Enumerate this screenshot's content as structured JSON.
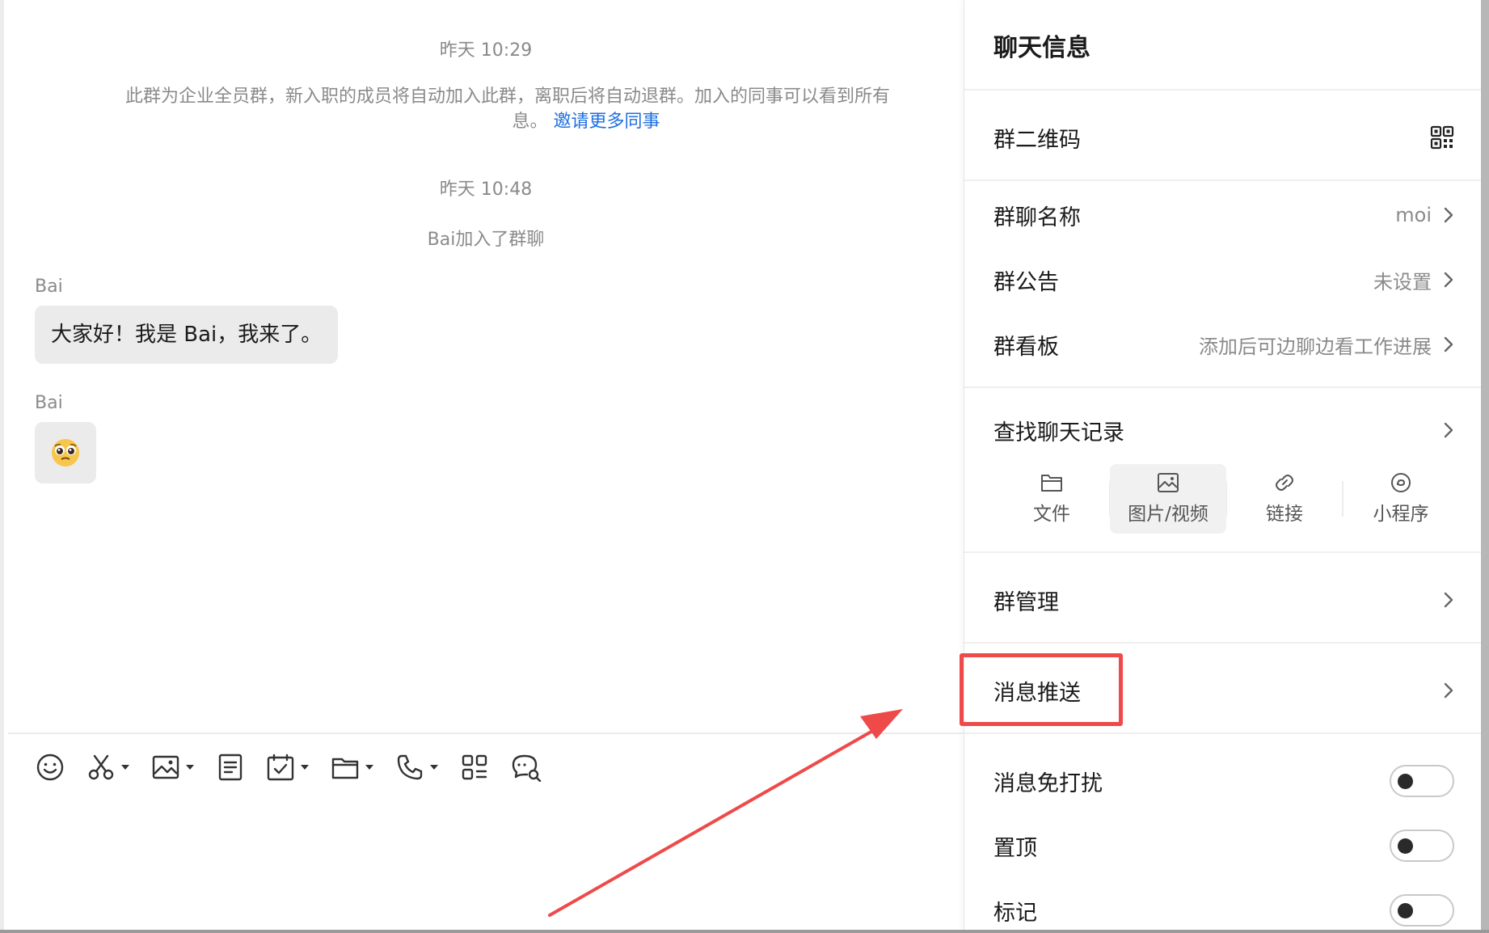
{
  "chat": {
    "timestamp_1": "昨天 10:29",
    "system_notice_line1": "此群为企业全员群，新入职的成员将自动加入此群，离职后将自动退群。加入的同事可以看到所有",
    "system_notice_line2_prefix": "息。",
    "invite_link": "邀请更多同事",
    "timestamp_2": "昨天 10:48",
    "join_notice": "Bai加入了群聊",
    "messages": [
      {
        "sender": "Bai",
        "text": "大家好！我是 Bai，我来了。"
      },
      {
        "sender": "Bai",
        "sticker": "🥺"
      }
    ]
  },
  "toolbar": {
    "tools": [
      {
        "icon": "emoji-icon",
        "has_menu": false
      },
      {
        "icon": "scissors-icon",
        "has_menu": true
      },
      {
        "icon": "image-icon",
        "has_menu": true
      },
      {
        "icon": "document-icon",
        "has_menu": false
      },
      {
        "icon": "calendar-check-icon",
        "has_menu": true
      },
      {
        "icon": "folder-icon",
        "has_menu": true
      },
      {
        "icon": "phone-icon",
        "has_menu": true
      },
      {
        "icon": "apps-grid-icon",
        "has_menu": false
      },
      {
        "icon": "chat-search-icon",
        "has_menu": false
      }
    ]
  },
  "panel": {
    "title": "聊天信息",
    "qr_code": {
      "label": "群二维码",
      "icon": "qr-code-icon"
    },
    "group_name": {
      "label": "群聊名称",
      "value": "moi"
    },
    "announcement": {
      "label": "群公告",
      "value": "未设置"
    },
    "kanban": {
      "label": "群看板",
      "value": "添加后可边聊边看工作进展"
    },
    "search_history": {
      "label": "查找聊天记录",
      "categories": [
        {
          "label": "文件",
          "icon": "folder-icon",
          "active": false
        },
        {
          "label": "图片/视频",
          "icon": "image-icon",
          "active": true
        },
        {
          "label": "链接",
          "icon": "link-icon",
          "active": false
        },
        {
          "label": "小程序",
          "icon": "mini-program-icon",
          "active": false
        }
      ]
    },
    "group_manage": {
      "label": "群管理"
    },
    "message_push": {
      "label": "消息推送"
    },
    "mute": {
      "label": "消息免打扰",
      "on": false
    },
    "pin": {
      "label": "置顶",
      "on": false
    },
    "mark": {
      "label": "标记",
      "on": false
    }
  },
  "annotation": {
    "highlight_color": "#ee4a4a",
    "target": "消息推送"
  }
}
